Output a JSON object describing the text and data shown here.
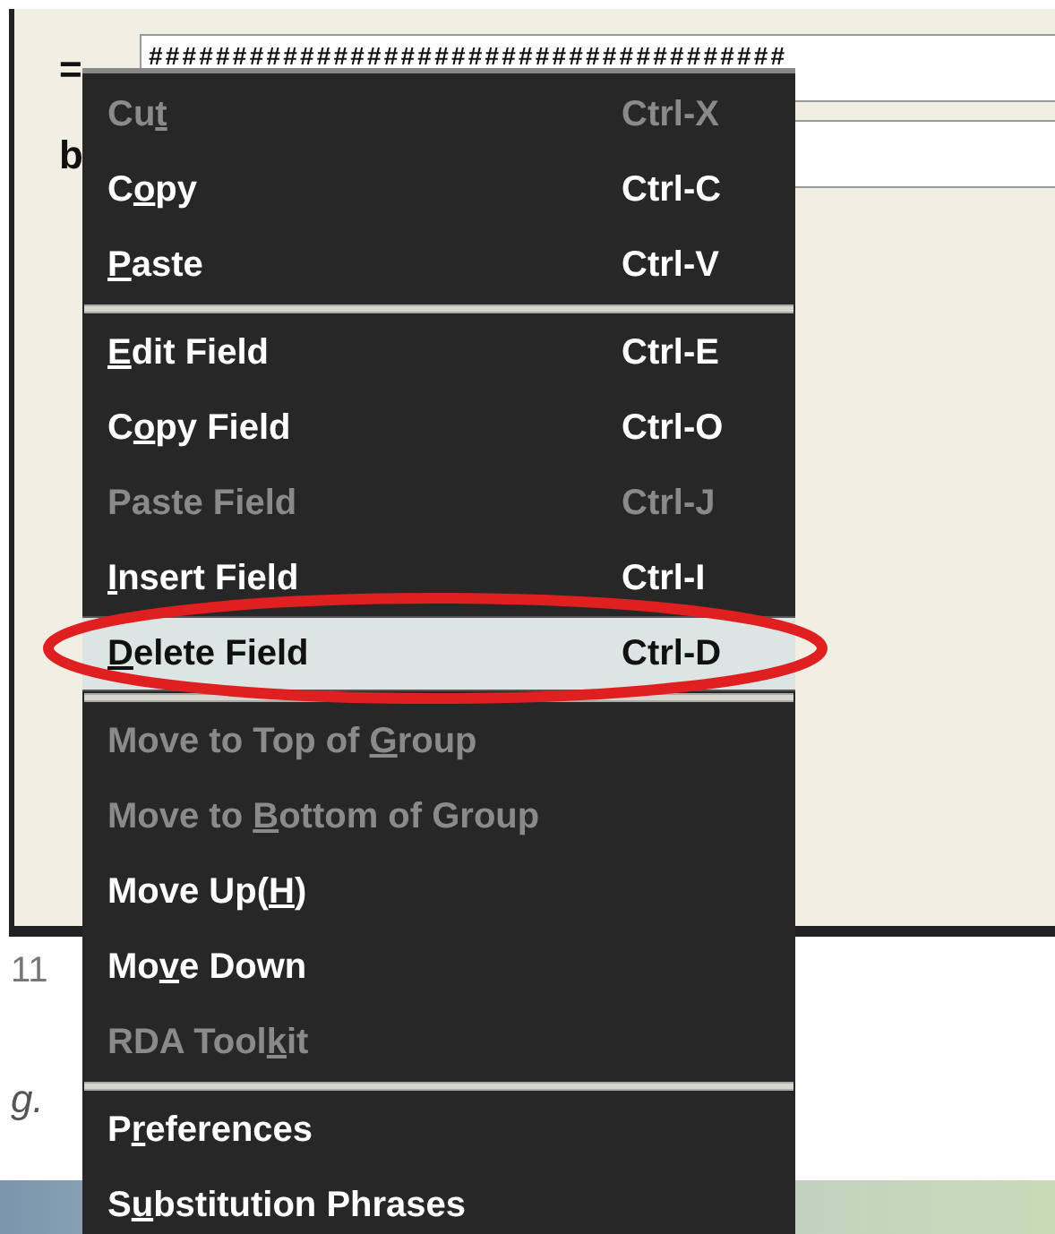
{
  "window": {
    "rows": [
      {
        "label": "=",
        "value": "######################################"
      },
      {
        "label": "b"
      }
    ]
  },
  "background": {
    "line_number": "11",
    "text": "g."
  },
  "context_menu": {
    "items": [
      {
        "kind": "item",
        "label": {
          "before": "Cu",
          "key": "t"
        },
        "shortcut": "Ctrl-X",
        "disabled": true,
        "selected": false
      },
      {
        "kind": "item",
        "label": {
          "before": "C",
          "key": "o",
          "after": "py"
        },
        "shortcut": "Ctrl-C",
        "disabled": false,
        "selected": false
      },
      {
        "kind": "item",
        "label": {
          "key": "P",
          "after": "aste"
        },
        "shortcut": "Ctrl-V",
        "disabled": false,
        "selected": false
      },
      {
        "kind": "separator"
      },
      {
        "kind": "item",
        "label": {
          "key": "E",
          "after": "dit Field"
        },
        "shortcut": "Ctrl-E",
        "disabled": false,
        "selected": false
      },
      {
        "kind": "item",
        "label": {
          "before": "C",
          "key": "o",
          "after": "py Field"
        },
        "shortcut": "Ctrl-O",
        "disabled": false,
        "selected": false
      },
      {
        "kind": "item",
        "label": {
          "before": "Paste Field"
        },
        "shortcut": "Ctrl-J",
        "disabled": true,
        "selected": false
      },
      {
        "kind": "item",
        "label": {
          "key": "I",
          "after": "nsert Field"
        },
        "shortcut": "Ctrl-I",
        "disabled": false,
        "selected": false
      },
      {
        "kind": "item",
        "label": {
          "key": "D",
          "after": "elete Field"
        },
        "shortcut": "Ctrl-D",
        "disabled": false,
        "selected": true,
        "circled": true
      },
      {
        "kind": "separator"
      },
      {
        "kind": "item",
        "label": {
          "before": "Move to Top of ",
          "key": "G",
          "after": "roup"
        },
        "disabled": true,
        "selected": false
      },
      {
        "kind": "item",
        "label": {
          "before": "Move to ",
          "key": "B",
          "after": "ottom of Group"
        },
        "disabled": true,
        "selected": false
      },
      {
        "kind": "item",
        "label": {
          "before": "Move Up(",
          "key": "H",
          "after": ")"
        },
        "disabled": false,
        "selected": false
      },
      {
        "kind": "item",
        "label": {
          "before": "Mo",
          "key": "v",
          "after": "e Down"
        },
        "disabled": false,
        "selected": false
      },
      {
        "kind": "item",
        "label": {
          "before": "RDA Tool",
          "key": "k",
          "after": "it"
        },
        "disabled": true,
        "selected": false
      },
      {
        "kind": "separator"
      },
      {
        "kind": "item",
        "label": {
          "before": "P",
          "key": "r",
          "after": "eferences"
        },
        "disabled": false,
        "selected": false
      },
      {
        "kind": "item",
        "label": {
          "before": "S",
          "key": "u",
          "after": "bstitution Phrases"
        },
        "disabled": false,
        "selected": false
      }
    ]
  }
}
